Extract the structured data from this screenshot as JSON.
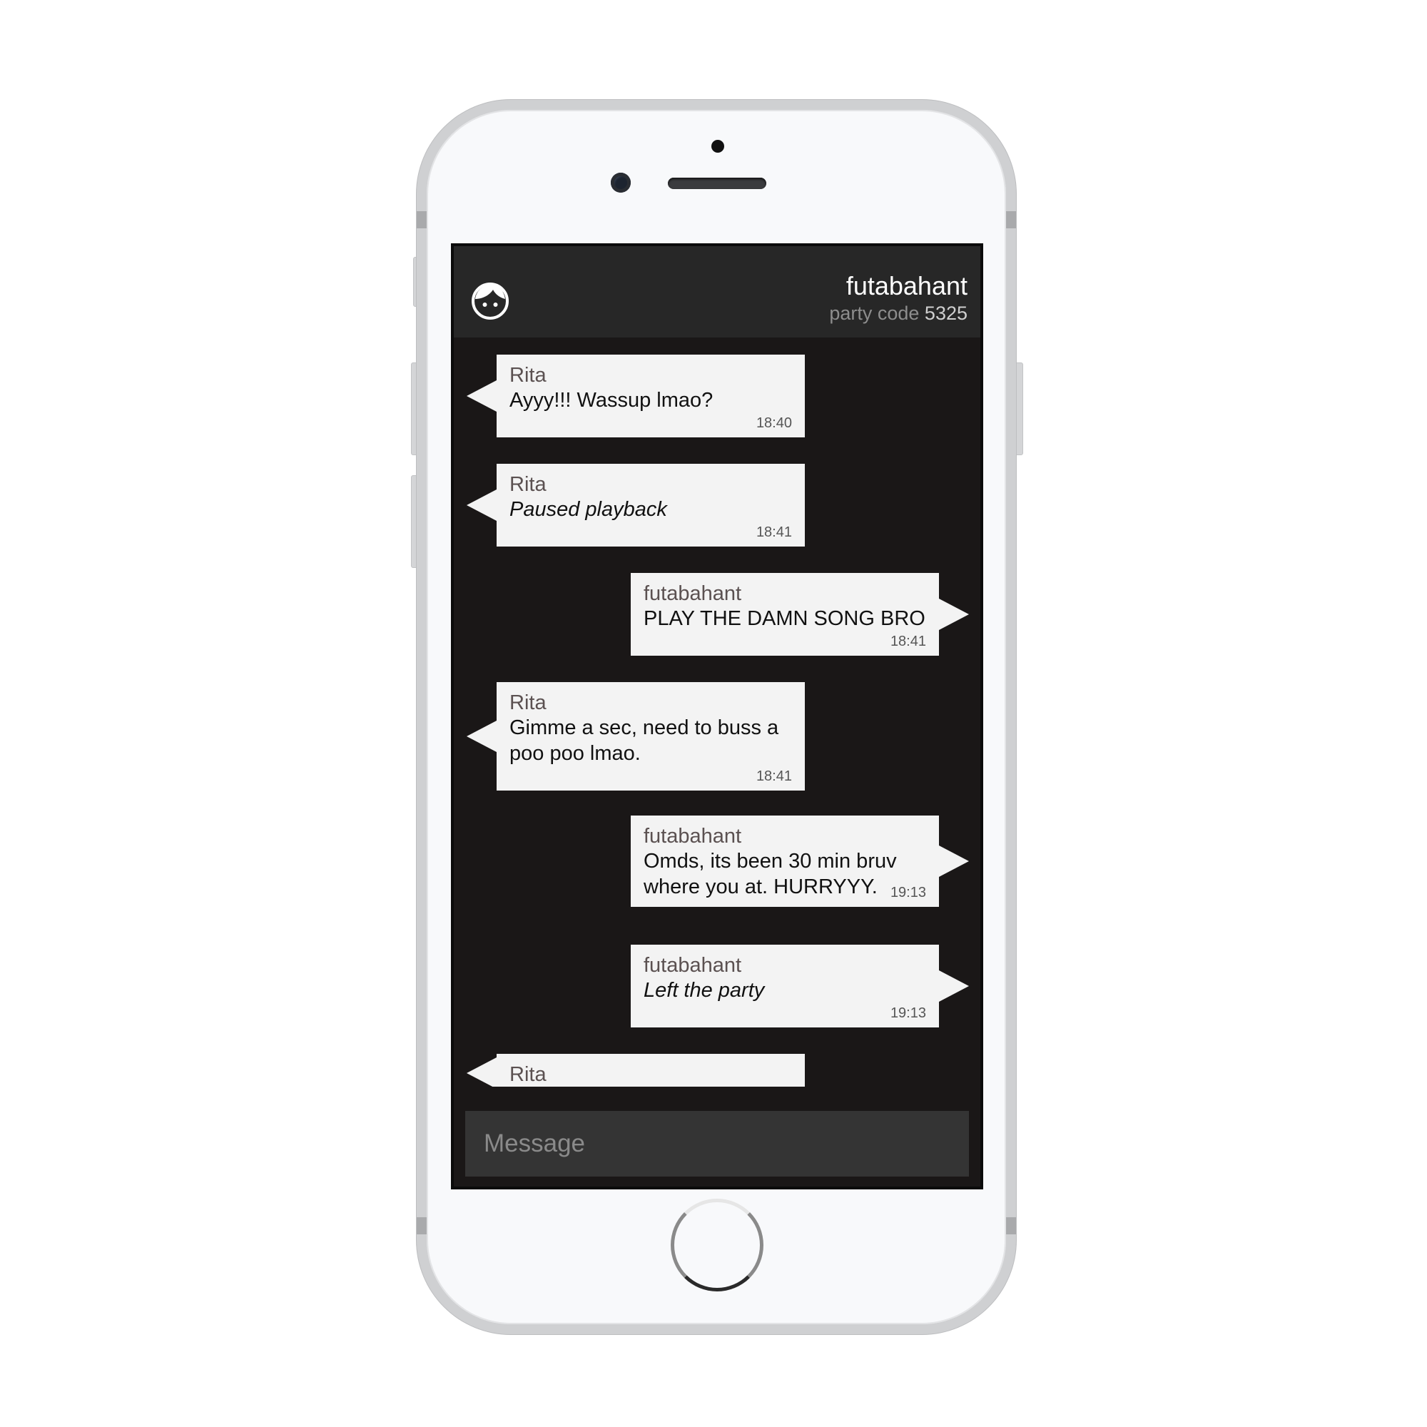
{
  "header": {
    "title": "futabahant",
    "party_code_label": "party code",
    "party_code": "5325",
    "avatar_icon": "face-icon"
  },
  "messages": [
    {
      "side": "left",
      "sender": "Rita",
      "text": "Ayyy!!! Wassup lmao?",
      "time": "18:40",
      "system": false
    },
    {
      "side": "left",
      "sender": "Rita",
      "text": "Paused playback",
      "time": "18:41",
      "system": true
    },
    {
      "side": "right",
      "sender": "futabahant",
      "text": "PLAY THE DAMN SONG BRO",
      "time": "18:41",
      "system": false
    },
    {
      "side": "left",
      "sender": "Rita",
      "text": "Gimme a sec, need to buss a poo poo lmao.",
      "time": "18:41",
      "system": false
    },
    {
      "side": "right",
      "sender": "futabahant",
      "text": "Omds, its been 30 min bruv where you at. HURRYYY.",
      "time": "19:13",
      "system": false
    },
    {
      "side": "right",
      "sender": "futabahant",
      "text": "Left the party",
      "time": "19:13",
      "system": true
    },
    {
      "side": "left",
      "sender": "Rita",
      "text": "",
      "time": "",
      "system": false
    }
  ],
  "composer": {
    "placeholder": "Message",
    "value": ""
  },
  "colors": {
    "header_bg": "#272727",
    "chat_bg": "#1a1717",
    "bubble_bg": "#f3f3f3",
    "composer_bg": "#343434"
  }
}
